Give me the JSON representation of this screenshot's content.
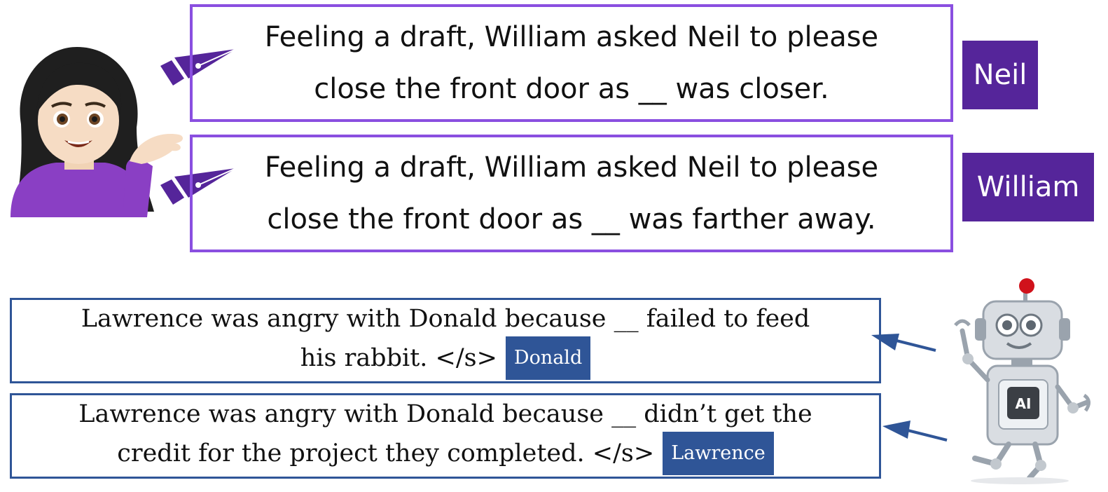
{
  "human_section": {
    "sentences": [
      {
        "line1": "Feeling a draft, William asked Neil to please",
        "line2": "close the front door as __ was closer.",
        "answer": "Neil"
      },
      {
        "line1": "Feeling a draft, William asked Neil to please",
        "line2": "close the front door as __ was farther away.",
        "answer": "William"
      }
    ]
  },
  "model_section": {
    "sentences": [
      {
        "line1": "Lawrence was angry with Donald because __ failed to feed",
        "line2": "his rabbit. </s>",
        "answer": "Donald"
      },
      {
        "line1": "Lawrence was angry with Donald because __ didn’t get the",
        "line2": "credit for the project they completed. </s>",
        "answer": "Lawrence"
      }
    ],
    "robot_chip_label": "AI"
  },
  "colors": {
    "human_accent": "#8a4fe0",
    "human_label_bg": "#55259a",
    "model_accent": "#2f5597"
  },
  "icons": {
    "person": "person-tipping-hand-icon",
    "pen": "fountain-pen-icon",
    "robot": "robot-icon",
    "arrow": "arrow-left-icon"
  }
}
